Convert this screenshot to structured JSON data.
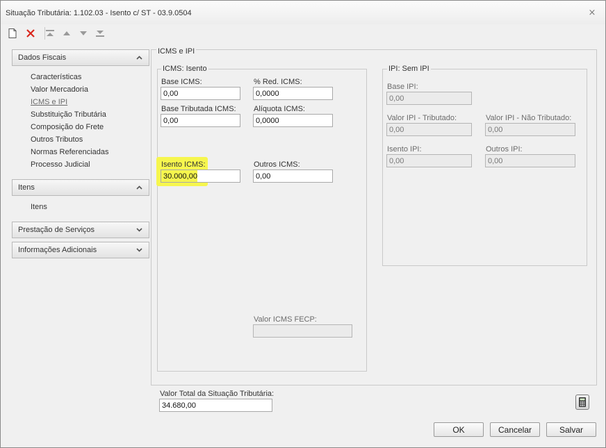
{
  "window": {
    "title": "Situação Tributária: 1.102.03 - Isento c/ ST - 03.9.0504",
    "close_glyph": "⨯"
  },
  "toolbar": {
    "items": [
      {
        "name": "new-document-icon"
      },
      {
        "name": "delete-icon"
      },
      {
        "name": "move-first-icon"
      },
      {
        "name": "move-up-icon"
      },
      {
        "name": "move-down-icon"
      },
      {
        "name": "move-last-icon"
      }
    ]
  },
  "sidebar": {
    "sections": [
      {
        "label": "Dados Fiscais",
        "expanded": true,
        "items": [
          "Características",
          "Valor Mercadoria",
          "ICMS e IPI",
          "Substituição Tributária",
          "Composição do Frete",
          "Outros Tributos",
          "Normas Referenciadas",
          "Processo Judicial"
        ],
        "active_item": "ICMS e IPI"
      },
      {
        "label": "Itens",
        "expanded": true,
        "items": [
          "Itens"
        ]
      },
      {
        "label": "Prestação de Serviços",
        "expanded": false
      },
      {
        "label": "Informações Adicionais",
        "expanded": false
      }
    ]
  },
  "main": {
    "section_title": "ICMS e IPI",
    "icms": {
      "group_title": "ICMS: Isento",
      "base_icms": {
        "label": "Base ICMS:",
        "value": "0,00"
      },
      "red_icms": {
        "label": "% Red. ICMS:",
        "value": "0,0000"
      },
      "base_tributada": {
        "label": "Base Tributada ICMS:",
        "value": "0,00"
      },
      "aliquota_icms": {
        "label": "Alíquota ICMS:",
        "value": "0,0000"
      },
      "isento_icms": {
        "label": "Isento ICMS:",
        "value": "30.000,00"
      },
      "outros_icms": {
        "label": "Outros ICMS:",
        "value": "0,00"
      },
      "valor_icms_fecp": {
        "label": "Valor ICMS FECP:",
        "value": ""
      }
    },
    "ipi": {
      "group_title": "IPI: Sem IPI",
      "base_ipi": {
        "label": "Base IPI:",
        "value": "0,00"
      },
      "valor_ipi_tributado": {
        "label": "Valor IPI - Tributado:",
        "value": "0,00"
      },
      "valor_ipi_nao_tributado": {
        "label": "Valor IPI - Não Tributado:",
        "value": "0,00"
      },
      "isento_ipi": {
        "label": "Isento IPI:",
        "value": "0,00"
      },
      "outros_ipi": {
        "label": "Outros IPI:",
        "value": "0,00"
      }
    },
    "total": {
      "label": "Valor Total da Situação Tributária:",
      "value": "34.680,00"
    }
  },
  "buttons": {
    "ok": "OK",
    "cancel": "Cancelar",
    "save": "Salvar"
  },
  "colors": {
    "highlight": "#f6f64e",
    "delete_red": "#d9261c"
  }
}
